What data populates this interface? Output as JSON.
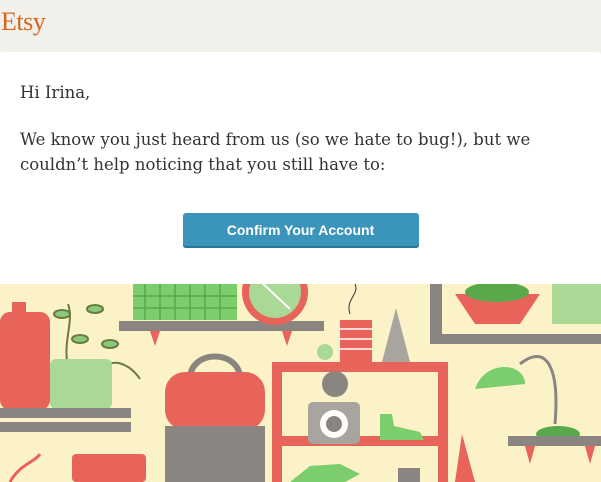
{
  "brand": {
    "logo_text": "Etsy",
    "color": "#d5641c"
  },
  "email": {
    "greeting": "Hi Irina,",
    "body": "We know you just heard from us (so we hate to bug!), but we couldn’t help noticing that you still have to:",
    "cta_label": "Confirm Your Account"
  },
  "colors": {
    "button": "#3b94b9",
    "illustration_bg": "#fbf3c7",
    "accent_red": "#e8635a",
    "accent_green": "#7ccd6b",
    "shelf_gray": "#8a8580"
  }
}
